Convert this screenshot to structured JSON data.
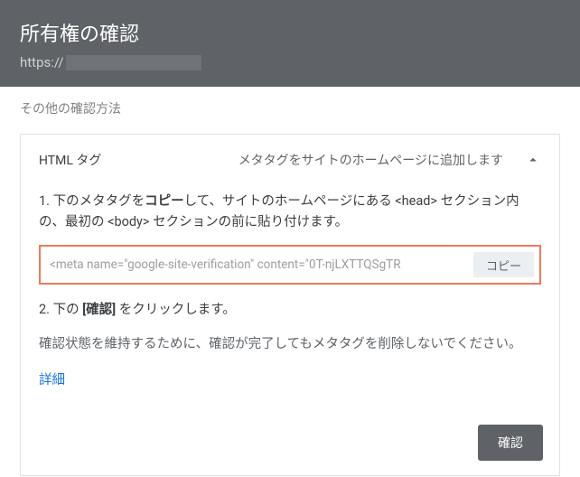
{
  "header": {
    "title": "所有権の確認",
    "url_prefix": "https://"
  },
  "subtitle": "その他の確認方法",
  "card": {
    "title": "HTML タグ",
    "description": "メタタグをサイトのホームページに追加します",
    "step1_prefix": "1. 下のメタタグを",
    "step1_bold": "コピー",
    "step1_suffix": "して、サイトのホームページにある <head> セクション内の、最初の <body> セクションの前に貼り付けます。",
    "meta_value": "<meta name=\"google-site-verification\" content=\"0T-njLXTTQSgTR",
    "copy_label": "コピー",
    "step2_prefix": "2. 下の ",
    "step2_bold": "[確認]",
    "step2_suffix": " をクリックします。",
    "note": "確認状態を維持するために、確認が完了してもメタタグを削除しないでください。",
    "details_link": "詳細",
    "confirm_label": "確認"
  }
}
